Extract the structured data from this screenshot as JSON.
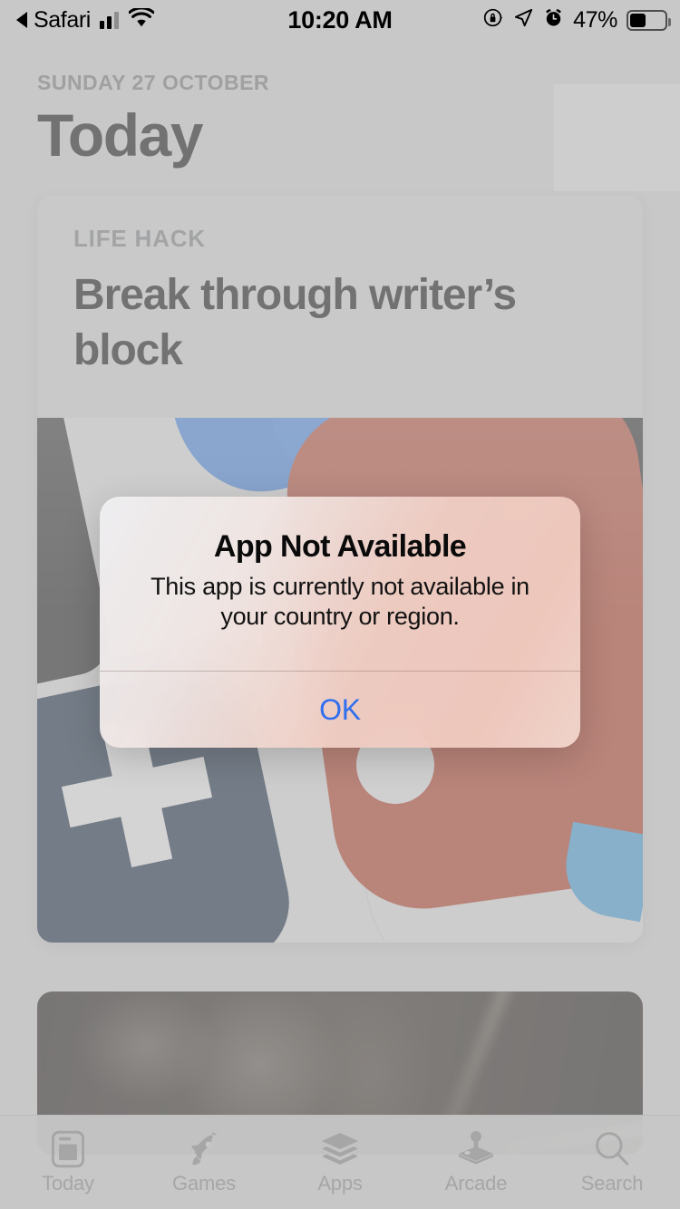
{
  "status_bar": {
    "back_label": "Safari",
    "time": "10:20 AM",
    "battery_percent": "47%",
    "battery_level": 47,
    "icons": [
      "back-arrow-icon",
      "signal-bars-icon",
      "wifi-icon",
      "rotation-lock-icon",
      "location-arrow-icon",
      "alarm-clock-icon",
      "battery-icon"
    ]
  },
  "header": {
    "date": "SUNDAY 27 OCTOBER",
    "title": "Today"
  },
  "hero_card": {
    "eyebrow": "LIFE HACK",
    "headline": "Break through writer’s block"
  },
  "alert": {
    "title": "App Not Available",
    "message": "This app is currently not available in your country or region.",
    "ok_label": "OK",
    "accent_color": "#2f6ff0"
  },
  "tab_bar": {
    "items": [
      {
        "label": "Today",
        "icon": "today-card-icon",
        "selected": false
      },
      {
        "label": "Games",
        "icon": "rocket-icon",
        "selected": false
      },
      {
        "label": "Apps",
        "icon": "layers-icon",
        "selected": false
      },
      {
        "label": "Arcade",
        "icon": "joystick-icon",
        "selected": false
      },
      {
        "label": "Search",
        "icon": "search-icon",
        "selected": false
      }
    ]
  }
}
